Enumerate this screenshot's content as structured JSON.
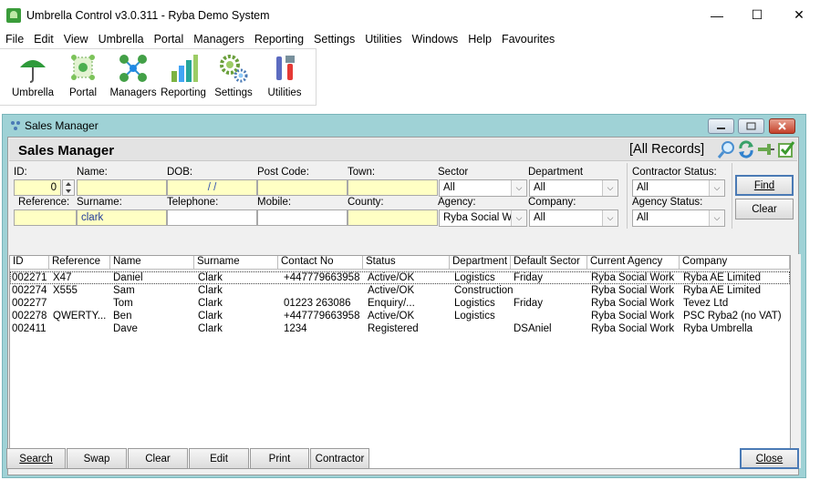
{
  "app": {
    "title": "Umbrella Control v3.0.311 - Ryba Demo System",
    "minimize": "—",
    "maximize": "☐",
    "close": "✕"
  },
  "menu": [
    "File",
    "Edit",
    "View",
    "Umbrella",
    "Portal",
    "Managers",
    "Reporting",
    "Settings",
    "Utilities",
    "Windows",
    "Help",
    "Favourites"
  ],
  "toolbar": {
    "umbrella": "Umbrella",
    "portal": "Portal",
    "managers": "Managers",
    "reporting": "Reporting",
    "settings": "Settings",
    "utilities": "Utilities"
  },
  "window": {
    "title": "Sales Manager",
    "header": "Sales Manager",
    "records": "[All Records]"
  },
  "search": {
    "id_label": "ID:",
    "id_value": "0",
    "name_label": "Name:",
    "name_value": "",
    "dob_label": "DOB:",
    "dob_value": "  /  /",
    "postcode_label": "Post Code:",
    "town_label": "Town:",
    "sector_label": "Sector",
    "sector_value": "All",
    "department_label": "Department",
    "department_value": "All",
    "contractor_status_label": "Contractor Status:",
    "contractor_status_value": "All",
    "reference_label": "Reference:",
    "surname_label": "Surname:",
    "surname_value": "clark",
    "telephone_label": "Telephone:",
    "mobile_label": "Mobile:",
    "county_label": "County:",
    "agency_label": "Agency:",
    "agency_value": "Ryba Social Wor",
    "company_label": "Company:",
    "company_value": "All",
    "agency_status_label": "Agency Status:",
    "agency_status_value": "All",
    "find": "Find",
    "clear": "Clear"
  },
  "grid": {
    "columns": [
      "ID",
      "Reference",
      "Name",
      "Surname",
      "Contact No",
      "Status",
      "Department",
      "Default Sector",
      "Current Agency",
      "Company"
    ],
    "rows": [
      [
        "002271",
        "X47",
        "Daniel",
        "Clark",
        "+447779663958",
        "Active/OK",
        "Logistics",
        "Friday",
        "Ryba Social Work",
        "Ryba AE Limited"
      ],
      [
        "002274",
        "X555",
        "Sam",
        "Clark",
        "",
        "Active/OK",
        "Construction",
        "",
        "Ryba Social Work",
        "Ryba AE Limited"
      ],
      [
        "002277",
        "",
        "Tom",
        "Clark",
        "01223 263086",
        "Enquiry/...",
        "Logistics",
        "Friday",
        "Ryba Social Work",
        "Tevez Ltd"
      ],
      [
        "002278",
        "QWERTY...",
        "Ben",
        "Clark",
        "+447779663958",
        "Active/OK",
        "Logistics",
        "",
        "Ryba Social Work",
        "PSC Ryba2 (no VAT)"
      ],
      [
        "002411",
        "",
        "Dave",
        "Clark",
        "1234",
        "Registered",
        "",
        "DSAniel",
        "Ryba Social Work",
        "Ryba Umbrella"
      ]
    ]
  },
  "buttons": {
    "search": "Search",
    "swap": "Swap",
    "clear": "Clear",
    "edit": "Edit",
    "print": "Print",
    "contractor": "Contractor",
    "close": "Close"
  },
  "colors": {
    "window_frame": "#9fd2d6",
    "required_field": "#ffffc4",
    "default_button_border": "#4a7ab5"
  }
}
